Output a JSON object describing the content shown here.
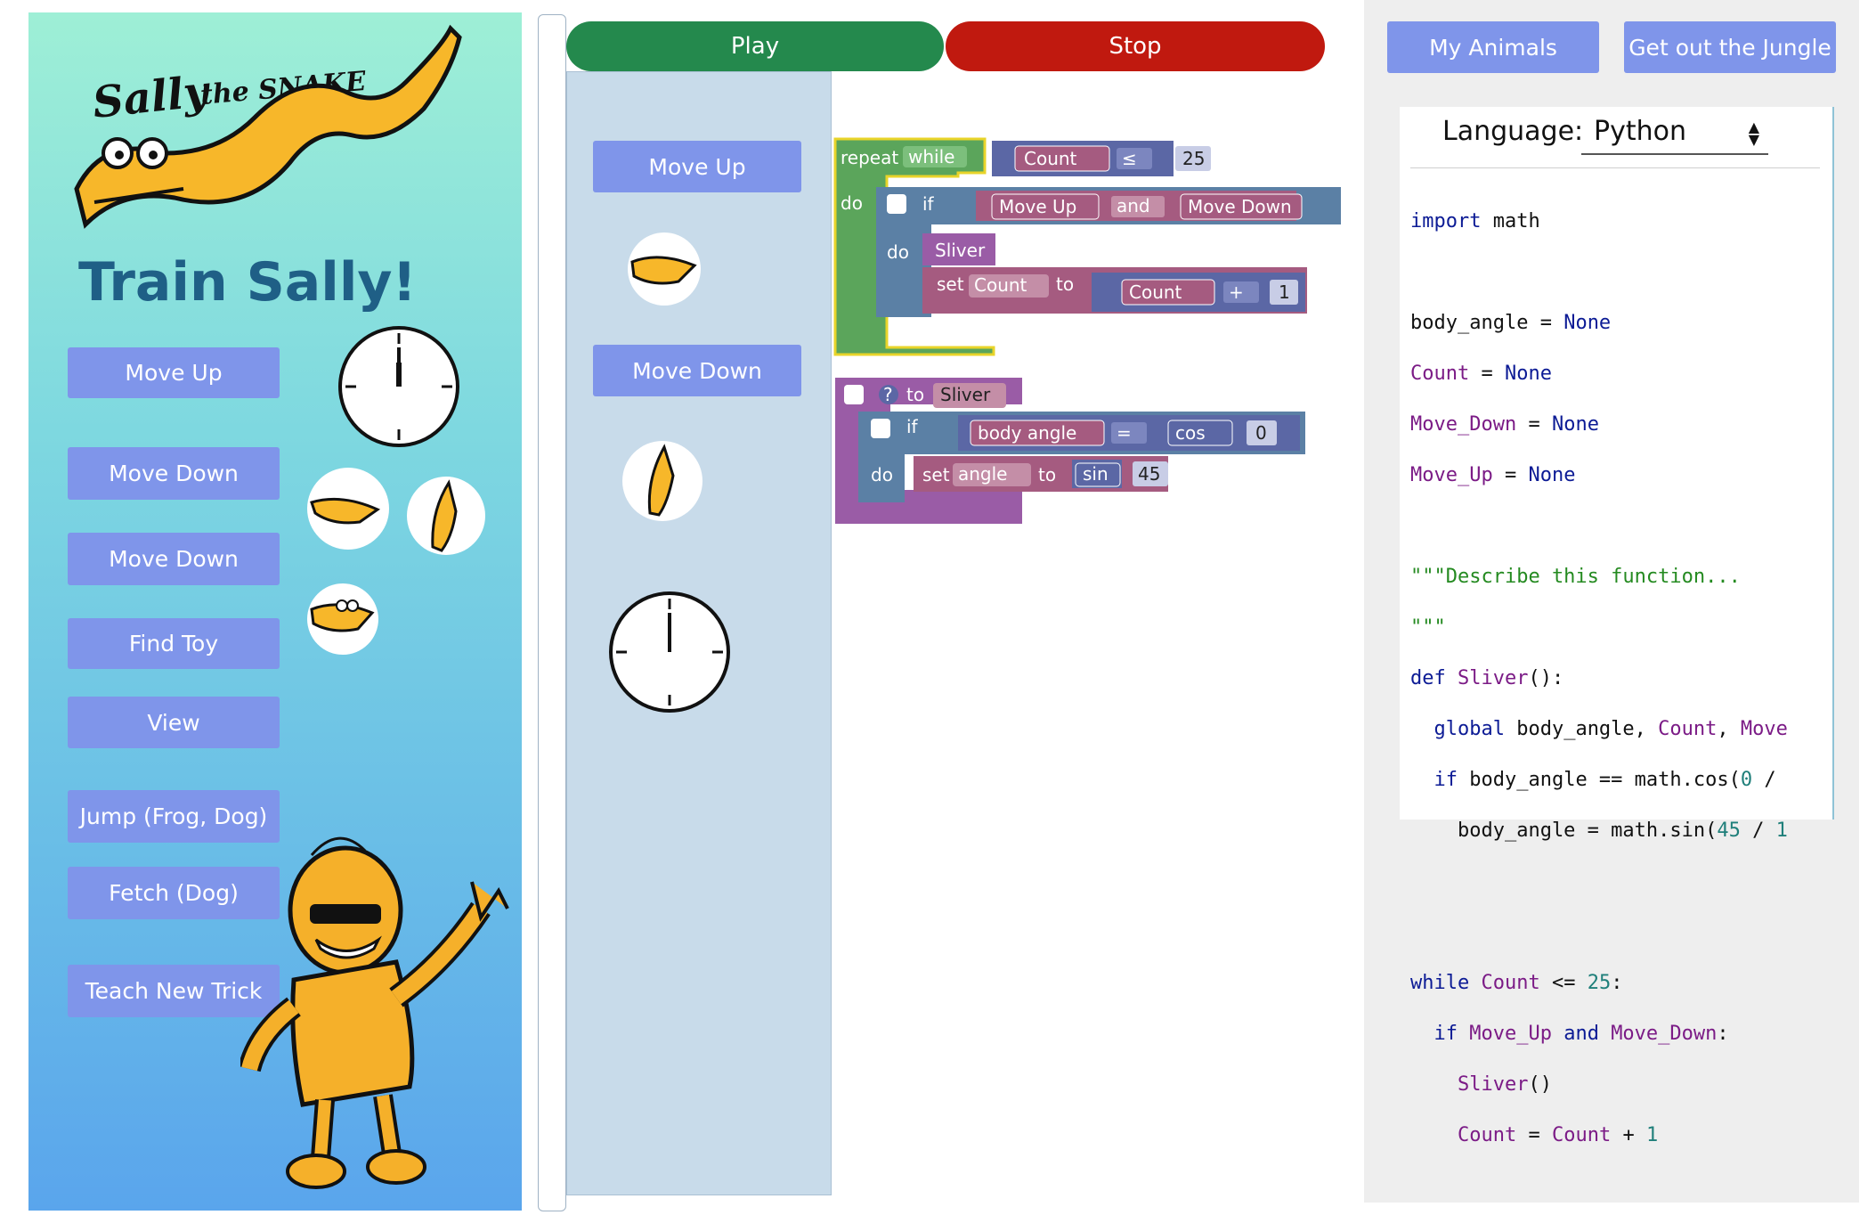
{
  "left": {
    "logo_text": "Sally the SNAKE",
    "title": "Train Sally!",
    "buttons": [
      "Move Up",
      "Move Down",
      "Move Down",
      "Find Toy",
      "View",
      "Jump (Frog, Dog)",
      "Fetch (Dog)",
      "Teach New Trick"
    ]
  },
  "toolbar": {
    "play_label": "Play",
    "stop_label": "Stop",
    "play_color": "#24894d",
    "stop_color": "#c0190f"
  },
  "nav": {
    "my_animals": "My Animals",
    "get_out": "Get out the Jungle"
  },
  "palette": {
    "move_up": "Move Up",
    "move_down": "Move Down"
  },
  "blocks": {
    "repeat": "repeat",
    "while": "while",
    "count": "Count",
    "lte": "≤",
    "limit": "25",
    "do": "do",
    "if": "if",
    "move_up": "Move Up",
    "and": "and",
    "move_down": "Move Down",
    "sliver": "Sliver",
    "set": "set",
    "to": "to",
    "plus": "+",
    "one": "1",
    "to_sliver": "to",
    "body_angle": "body angle",
    "eq": "=",
    "cos": "cos",
    "zero": "0",
    "angle": "angle",
    "sin": "sin",
    "fortyfive": "45",
    "question": "?"
  },
  "code": {
    "language_label": "Language:",
    "language_value": "Python",
    "lines": [
      "import math",
      "",
      "body_angle = None",
      "Count = None",
      "Move_Down = None",
      "Move_Up = None",
      "",
      "\"\"\"Describe this function...",
      "\"\"\"",
      "def Sliver():",
      "  global body_angle, Count, Move",
      "  if body_angle == math.cos(0 /",
      "    body_angle = math.sin(45 / 1",
      "",
      "",
      "while Count <= 25:",
      "  if Move_Up and Move_Down:",
      "    Sliver()",
      "    Count = Count + 1"
    ]
  }
}
